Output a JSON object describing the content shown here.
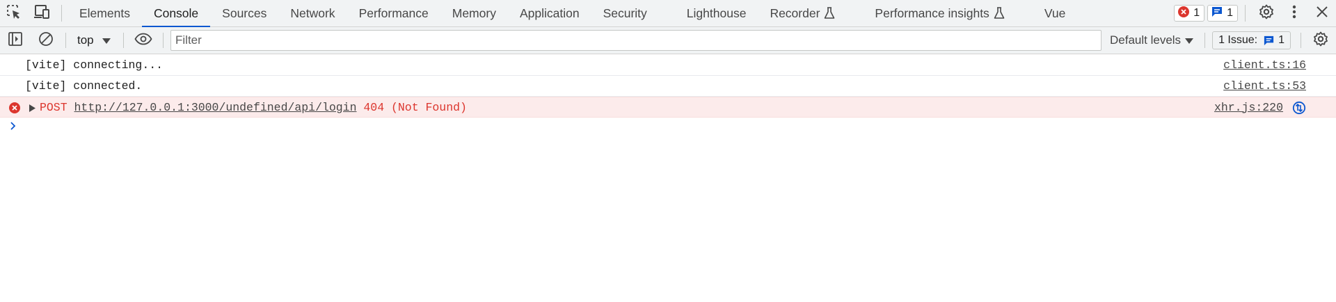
{
  "tabs": [
    {
      "label": "Elements",
      "active": false
    },
    {
      "label": "Console",
      "active": true
    },
    {
      "label": "Sources",
      "active": false
    },
    {
      "label": "Network",
      "active": false
    },
    {
      "label": "Performance",
      "active": false
    },
    {
      "label": "Memory",
      "active": false
    },
    {
      "label": "Application",
      "active": false
    },
    {
      "label": "Security",
      "active": false
    },
    {
      "label": "Lighthouse",
      "active": false
    },
    {
      "label": "Recorder",
      "active": false,
      "experimental": true
    },
    {
      "label": "Performance insights",
      "active": false,
      "experimental": true
    },
    {
      "label": "Vue",
      "active": false
    }
  ],
  "status": {
    "error_count": "1",
    "message_count": "1"
  },
  "console_toolbar": {
    "context": "top",
    "filter_placeholder": "Filter",
    "levels_label": "Default levels",
    "issues_label": "1 Issue:",
    "issues_count": "1"
  },
  "messages": [
    {
      "text": "[vite] connecting...",
      "source": "client.ts:16",
      "level": "log"
    },
    {
      "text": "[vite] connected.",
      "source": "client.ts:53",
      "level": "log"
    },
    {
      "method": "POST",
      "url": "http://127.0.0.1:3000/undefined/api/login",
      "status": "404 (Not Found)",
      "source": "xhr.js:220",
      "level": "error"
    }
  ],
  "colors": {
    "accent": "#0b57d0",
    "error": "#dc362e",
    "error_bg": "#fcebeb"
  },
  "icons": [
    "inspect-icon",
    "device-toggle-icon",
    "flask-icon",
    "error-circle-icon",
    "message-icon",
    "gear-icon",
    "kebab-icon",
    "close-icon",
    "sidebar-icon",
    "clear-icon",
    "eye-icon",
    "chevron-down-icon",
    "expand-triangle-icon",
    "network-request-icon",
    "prompt-chevron-icon"
  ]
}
